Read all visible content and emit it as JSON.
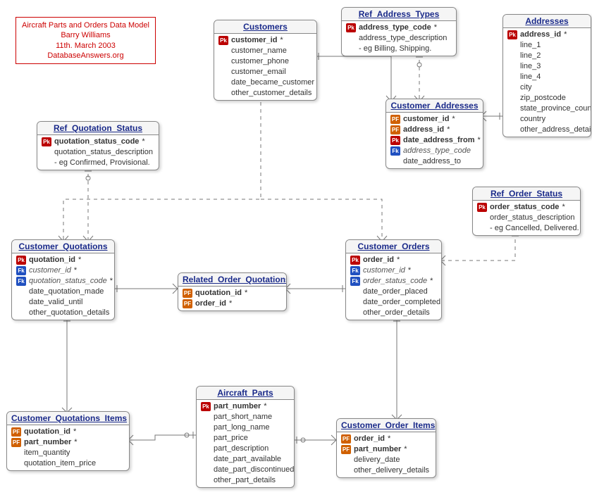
{
  "title": {
    "line1": "Aircraft Parts and Orders Data Model",
    "line2": "Barry Williams",
    "line3": "11th. March 2003",
    "line4": "DatabaseAnswers.org"
  },
  "key_labels": {
    "pk": "Pk",
    "fk": "Fk",
    "pf": "PF"
  },
  "entities": {
    "customers": {
      "title": "Customers",
      "attrs": [
        {
          "key": "pk",
          "name": "customer_id",
          "suffix": "*",
          "bold": true
        },
        {
          "key": "",
          "name": "customer_name"
        },
        {
          "key": "",
          "name": "customer_phone"
        },
        {
          "key": "",
          "name": "customer_email"
        },
        {
          "key": "",
          "name": "date_became_customer"
        },
        {
          "key": "",
          "name": "other_customer_details"
        }
      ]
    },
    "ref_address_types": {
      "title": "Ref_Address_Types",
      "attrs": [
        {
          "key": "pk",
          "name": "address_type_code",
          "suffix": "*",
          "bold": true
        },
        {
          "key": "",
          "name": "address_type_description"
        },
        {
          "key": "",
          "name": "- eg Billing, Shipping."
        }
      ]
    },
    "addresses": {
      "title": "Addresses",
      "attrs": [
        {
          "key": "pk",
          "name": "address_id",
          "suffix": "*",
          "bold": true
        },
        {
          "key": "",
          "name": "line_1"
        },
        {
          "key": "",
          "name": "line_2"
        },
        {
          "key": "",
          "name": "line_3"
        },
        {
          "key": "",
          "name": "line_4"
        },
        {
          "key": "",
          "name": "city"
        },
        {
          "key": "",
          "name": "zip_postcode"
        },
        {
          "key": "",
          "name": "state_province_county"
        },
        {
          "key": "",
          "name": "country"
        },
        {
          "key": "",
          "name": "other_address_details"
        }
      ]
    },
    "customer_addresses": {
      "title": "Customer_Addresses",
      "attrs": [
        {
          "key": "pf",
          "name": "customer_id",
          "suffix": "*",
          "bold": true
        },
        {
          "key": "pf",
          "name": "address_id",
          "suffix": "*",
          "bold": true
        },
        {
          "key": "pk",
          "name": "date_address_from",
          "suffix": "*",
          "bold": true
        },
        {
          "key": "fk",
          "name": "address_type_code",
          "italic": true
        },
        {
          "key": "",
          "name": "date_address_to"
        }
      ]
    },
    "ref_quotation_status": {
      "title": "Ref_Quotation_Status",
      "attrs": [
        {
          "key": "pk",
          "name": "quotation_status_code",
          "suffix": "*",
          "bold": true
        },
        {
          "key": "",
          "name": "quotation_status_description"
        },
        {
          "key": "",
          "name": "- eg Confirmed, Provisional."
        }
      ]
    },
    "customer_quotations": {
      "title": "Customer_Quotations",
      "attrs": [
        {
          "key": "pk",
          "name": "quotation_id",
          "suffix": "*",
          "bold": true
        },
        {
          "key": "fk",
          "name": "customer_id",
          "suffix": "*",
          "italic": true
        },
        {
          "key": "fk",
          "name": "quotation_status_code",
          "suffix": "*",
          "italic": true
        },
        {
          "key": "",
          "name": "date_quotation_made"
        },
        {
          "key": "",
          "name": "date_valid_until"
        },
        {
          "key": "",
          "name": "other_quotation_details"
        }
      ]
    },
    "related_order_quotations": {
      "title": "Related_Order_Quotations",
      "attrs": [
        {
          "key": "pf",
          "name": "quotation_id",
          "suffix": "*",
          "bold": true
        },
        {
          "key": "pf",
          "name": "order_id",
          "suffix": "*",
          "bold": true
        }
      ]
    },
    "customer_orders": {
      "title": "Customer_Orders",
      "attrs": [
        {
          "key": "pk",
          "name": "order_id",
          "suffix": "*",
          "bold": true
        },
        {
          "key": "fk",
          "name": "customer_id",
          "suffix": "*",
          "italic": true
        },
        {
          "key": "fk",
          "name": "order_status_code",
          "suffix": "*",
          "italic": true
        },
        {
          "key": "",
          "name": "date_order_placed"
        },
        {
          "key": "",
          "name": "date_order_completed"
        },
        {
          "key": "",
          "name": "other_order_details"
        }
      ]
    },
    "ref_order_status": {
      "title": "Ref_Order_Status",
      "attrs": [
        {
          "key": "pk",
          "name": "order_status_code",
          "suffix": "*",
          "bold": true
        },
        {
          "key": "",
          "name": "order_status_description"
        },
        {
          "key": "",
          "name": "- eg Cancelled, Delivered."
        }
      ]
    },
    "aircraft_parts": {
      "title": "Aircraft_Parts",
      "attrs": [
        {
          "key": "pk",
          "name": "part_number",
          "suffix": "*",
          "bold": true
        },
        {
          "key": "",
          "name": "part_short_name"
        },
        {
          "key": "",
          "name": "part_long_name"
        },
        {
          "key": "",
          "name": "part_price"
        },
        {
          "key": "",
          "name": "part_description"
        },
        {
          "key": "",
          "name": "date_part_available"
        },
        {
          "key": "",
          "name": "date_part_discontinued"
        },
        {
          "key": "",
          "name": "other_part_details"
        }
      ]
    },
    "customer_quotations_items": {
      "title": "Customer_Quotations_Items",
      "attrs": [
        {
          "key": "pf",
          "name": "quotation_id",
          "suffix": "*",
          "bold": true
        },
        {
          "key": "pf",
          "name": "part_number",
          "suffix": "*",
          "bold": true
        },
        {
          "key": "",
          "name": "item_quantity"
        },
        {
          "key": "",
          "name": "quotation_item_price"
        }
      ]
    },
    "customer_order_items": {
      "title": "Customer_Order_Items",
      "attrs": [
        {
          "key": "pf",
          "name": "order_id",
          "suffix": "*",
          "bold": true
        },
        {
          "key": "pf",
          "name": "part_number",
          "suffix": "*",
          "bold": true
        },
        {
          "key": "",
          "name": "delivery_date"
        },
        {
          "key": "",
          "name": "other_delivery_details"
        }
      ]
    }
  }
}
